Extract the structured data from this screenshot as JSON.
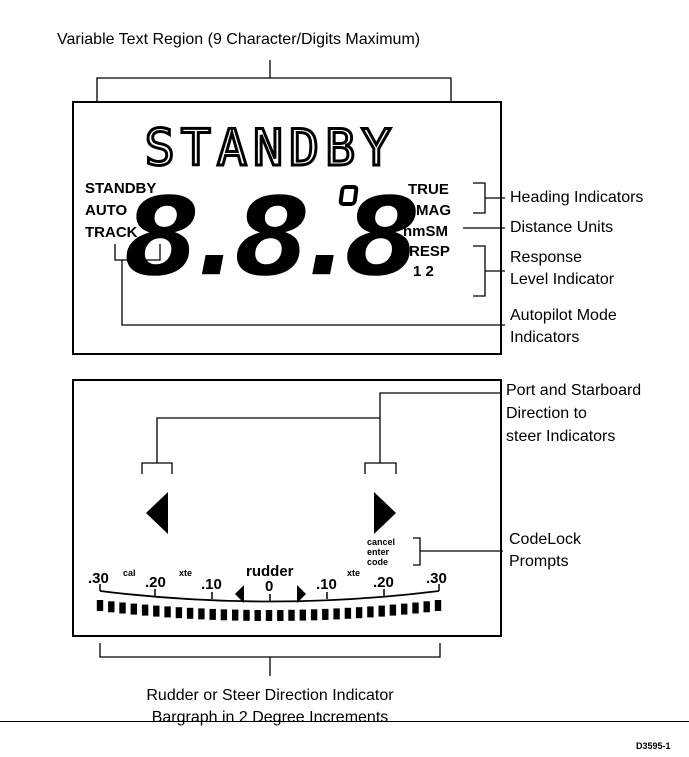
{
  "callouts": {
    "variable_text": "Variable Text Region (9 Character/Digits Maximum)",
    "heading_indicators": "Heading Indicators",
    "distance_units": "Distance Units",
    "response_line1": "Response",
    "response_line2": "Level Indicator",
    "autopilot_line1": "Autopilot Mode",
    "autopilot_line2": "Indicators",
    "direction_line1": "Port and Starboard",
    "direction_line2": "Direction to",
    "direction_line3": "steer Indicators",
    "codelock_line1": "CodeLock",
    "codelock_line2": "Prompts",
    "rudder_line1": "Rudder or Steer Direction Indicator",
    "rudder_line2": "Bargraph in 2 Degree Increments"
  },
  "upper_display": {
    "main_text": "STANDBY",
    "digits": "8.8.8",
    "degree_symbol": "°",
    "modes": [
      "STANDBY",
      "AUTO",
      "TRACK"
    ],
    "right_indicators": {
      "true": "TRUE",
      "mag": "MAG",
      "nm": "nm",
      "sm": "SM",
      "resp": "RESP",
      "levels": "1 2"
    }
  },
  "lower_display": {
    "codelock": [
      "cancel",
      "enter",
      "code"
    ],
    "rudder_label": "rudder",
    "cal": "cal",
    "xte_left": "xte",
    "xte_right": "xte",
    "scale": [
      ".30",
      ".20",
      ".10",
      "0",
      ".10",
      ".20",
      ".30"
    ]
  },
  "figure_code": "D3595-1"
}
